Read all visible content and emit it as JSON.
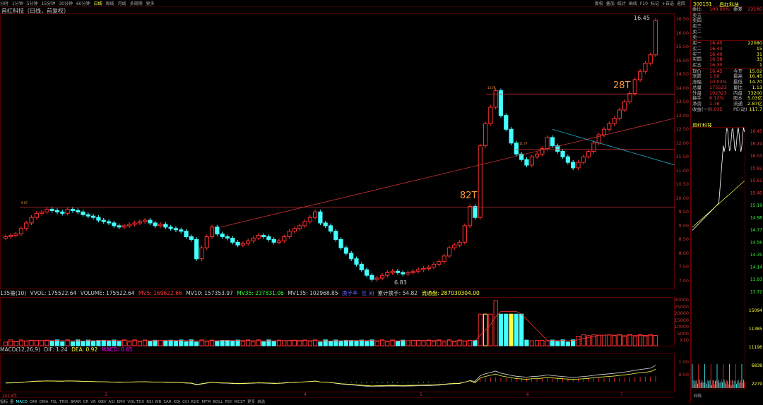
{
  "topbar": {
    "tabs": [
      "分时",
      "1分钟",
      "5分钟",
      "15分钟",
      "30分钟",
      "60分钟",
      "日线",
      "周线",
      "月线",
      "多周期",
      "更多"
    ],
    "active_index": 6,
    "right_tools": [
      "复权",
      "叠加",
      "统计",
      "画线",
      "F10",
      "标记",
      "+自选",
      "返回"
    ]
  },
  "title": "昌红科技（日线，前复权）",
  "price_axis": [
    "16.50",
    "16.00",
    "15.50",
    "15.00",
    "14.50",
    "14.00",
    "13.50",
    "13.00",
    "12.50",
    "12.00",
    "11.50",
    "11.00",
    "10.50",
    "10.00",
    "9.50",
    "9.00",
    "8.50",
    "8.00",
    "7.50",
    "7.00"
  ],
  "annotations": {
    "top_price": "16.45",
    "low_price": "6.83",
    "label_82t": "82T",
    "label_28t": "28T",
    "level_left": "9.67",
    "level_mid": "13.78",
    "level_wedge": "11.77"
  },
  "volume": {
    "header_prefix": "135量(10)",
    "vvol": "VVOL: 175522.64",
    "volume": "VOLUME: 175522.64",
    "mv5": "MV5: 169622.66",
    "mv10": "MV10: 157353.97",
    "mv35": "MV35: 237831.06",
    "mv135": "MV135: 102968.85",
    "extra1": "换手率",
    "extra2": "区 间",
    "turnover": "累计换手: 54.82",
    "float": "流通盘: 287030304.00",
    "axis": [
      "30000",
      "25000",
      "20000",
      "15000",
      "10000",
      "5000",
      "X10"
    ]
  },
  "macd": {
    "header": "MACD(12,26,9)",
    "dif": "DIF: 1.24",
    "dea": "DEA: 0.92",
    "macd": "MACD: 0.65",
    "axis": [
      "1.00",
      "0.50"
    ]
  },
  "dates": [
    "2019年",
    "3",
    "4",
    "5",
    "6",
    "7"
  ],
  "bottom_tabs": [
    "指标",
    "量",
    "MACD",
    "DMI",
    "DMA",
    "FSL",
    "TRIX",
    "BRAR",
    "CR",
    "VR",
    "OBV",
    "ASI",
    "EMV",
    "VOL-TDX",
    "RSI",
    "WR",
    "SAR",
    "KDJ",
    "CCI",
    "ROC",
    "MTM",
    "BOLL",
    "PSY",
    "MCST",
    "更多",
    "自选"
  ],
  "bottom_active": 2,
  "side": {
    "header_tabs": [
      "系统",
      "指标",
      "分时"
    ],
    "code": "300151",
    "name": "昌红科技",
    "ratio_row": {
      "k": "委比",
      "v": "100.00%",
      "v2": "委差",
      "q": "22160"
    },
    "sells": [
      {
        "k": "卖五",
        "v": "",
        "q": ""
      },
      {
        "k": "卖四",
        "v": "",
        "q": ""
      },
      {
        "k": "卖三",
        "v": "",
        "q": ""
      },
      {
        "k": "卖二",
        "v": "",
        "q": ""
      },
      {
        "k": "卖一",
        "v": "",
        "q": ""
      }
    ],
    "buys": [
      {
        "k": "买一",
        "v": "16.45",
        "q": "22080"
      },
      {
        "k": "买二",
        "v": "16.43",
        "q": "15"
      },
      {
        "k": "买三",
        "v": "16.40",
        "q": "31"
      },
      {
        "k": "买四",
        "v": "16.38",
        "q": "33"
      },
      {
        "k": "买五",
        "v": "16.35",
        "q": "1"
      }
    ],
    "stats": [
      {
        "k": "现价",
        "v": "16.45",
        "k2": "今开",
        "q": "15.02"
      },
      {
        "k": "涨跌",
        "v": "1.50",
        "k2": "最高",
        "q": "16.45"
      },
      {
        "k": "涨幅",
        "v": "10.03%",
        "k2": "最低",
        "q": "14.70"
      },
      {
        "k": "总量",
        "v": "175523",
        "k2": "量比",
        "q": "1.13"
      },
      {
        "k": "外盘",
        "v": "102323",
        "k2": "内盘",
        "q": "73200"
      },
      {
        "k": "换手",
        "v": "6.12%",
        "k2": "股本",
        "q": "5.03亿"
      },
      {
        "k": "净资",
        "v": "1.76",
        "k2": "流通",
        "q": "2.87亿"
      },
      {
        "k": "收益(一)",
        "v": "0.035",
        "k2": "PE(动)",
        "q": "117.7"
      }
    ],
    "mini_title": "昌红科技",
    "mini_axis": [
      "16.45",
      "16.24",
      "16.03",
      "15.82",
      "15.61",
      "15.40",
      "15.19",
      "14.98",
      "14.77",
      "14.56",
      "14.35",
      "14.14",
      "13.93",
      "13.72"
    ],
    "mini_vol_axis": [
      "15094",
      "11385",
      "11196",
      "6838",
      "2279"
    ],
    "mini_bottom": "日线"
  },
  "colors": {
    "up": "#ff3030",
    "down": "#44ffff",
    "grid": "#5a0000",
    "yellow": "#ffff40"
  }
}
